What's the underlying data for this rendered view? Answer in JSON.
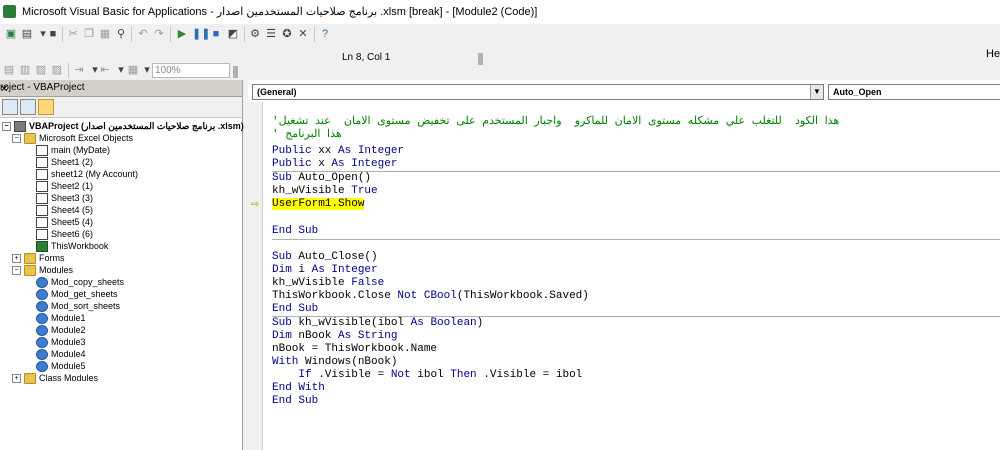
{
  "window": {
    "title": "Microsoft Visual Basic for Applications - برنامج صلاحيات المستخدمين اصدار .xlsm [break] - [Module2 (Code)]"
  },
  "toolbar": {
    "position": "Ln 8, Col 1",
    "zoom": "100%"
  },
  "menu": {
    "help": "Hel"
  },
  "project": {
    "title": "roject - VBAProject",
    "close": "✕",
    "root": "VBAProject (برنامج صلاحيات المستخدمين اصدار .xlsm)",
    "excel_objects": "Microsoft Excel Objects",
    "sheets": [
      "main (MyDate)",
      "Sheet1 (2)",
      "sheet12 (My Account)",
      "Sheet2 (1)",
      "Sheet3 (3)",
      "Sheet4 (5)",
      "Sheet5 (4)",
      "Sheet6 (6)",
      "ThisWorkbook"
    ],
    "forms": "Forms",
    "modules_label": "Modules",
    "modules": [
      "Mod_copy_sheets",
      "Mod_get_sheets",
      "Mod_sort_sheets",
      "Module1",
      "Module2",
      "Module3",
      "Module4",
      "Module5"
    ],
    "class_modules": "Class Modules"
  },
  "code": {
    "object_combo": "(General)",
    "proc_combo": "Auto_Open",
    "comment1": "'هذا الكود  للتغلب علي مشكله مستوى الامان للماكرو  واجبار المستخدم على تخفيض مستوى الامان  عند تشغيل",
    "comment2": "' هذا البرنامج",
    "l_public1_kw": "Public",
    "l_public1_mid": " xx ",
    "l_as1": "As Integer",
    "l_public2_kw": "Public",
    "l_public2_mid": " x ",
    "l_as2": "As Integer",
    "l_sub1_kw": "Sub",
    "l_sub1_name": " Auto_Open()",
    "l_kh1": "kh_wVisible ",
    "l_true": "True",
    "l_show": "UserForm1.Show",
    "l_endsub1": "End Sub",
    "l_sub2_kw": "Sub",
    "l_sub2_name": " Auto_Close()",
    "l_dim1_kw": "Dim",
    "l_dim1_mid": " i ",
    "l_dim1_as": "As Integer",
    "l_kh2": "kh_wVisible ",
    "l_false": "False",
    "l_close_a": "ThisWorkbook.Close ",
    "l_close_not": "Not",
    "l_close_b": " ",
    "l_close_cbool": "CBool",
    "l_close_c": "(ThisWorkbook.Saved)",
    "l_endsub2": "End Sub",
    "l_sub3_kw": "Sub",
    "l_sub3_a": " kh_wVisible(ibol ",
    "l_sub3_as": "As Boolean",
    "l_sub3_b": ")",
    "l_dim2_kw": "Dim",
    "l_dim2_mid": " nBook ",
    "l_dim2_as": "As String",
    "l_nbook": "nBook = ThisWorkbook.Name",
    "l_with_kw": "With",
    "l_with_rest": " Windows(nBook)",
    "l_if_pre": "    ",
    "l_if_kw": "If",
    "l_if_a": " .Visible = ",
    "l_if_not": "Not",
    "l_if_b": " ibol ",
    "l_if_then": "Then",
    "l_if_c": " .Visible = ibol",
    "l_endwith": "End With",
    "l_endsub3": "End Sub"
  }
}
